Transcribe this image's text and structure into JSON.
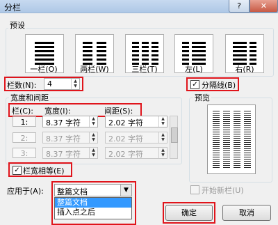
{
  "window": {
    "title": "分栏",
    "help_label": "?",
    "close_label": "✕"
  },
  "presets": {
    "label": "预设",
    "items": [
      {
        "label": "一栏(O)"
      },
      {
        "label": "两栏(W)"
      },
      {
        "label": "三栏(T)"
      },
      {
        "label": "左(L)"
      },
      {
        "label": "右(R)"
      }
    ]
  },
  "columns": {
    "label": "栏数(N):",
    "value": "4"
  },
  "divider": {
    "label": "分隔线(B)",
    "checked": true
  },
  "width_spacing": {
    "label": "宽度和间距",
    "col_header": "栏(C):",
    "width_header": "宽度(I):",
    "spacing_header": "间距(S):",
    "rows": [
      {
        "num": "1:",
        "width": "8.37 字符",
        "spacing": "2.02 字符"
      },
      {
        "num": "2:",
        "width": "8.37 字符",
        "spacing": "2.02 字符"
      },
      {
        "num": "3:",
        "width": "8.37 字符",
        "spacing": "2.02 字符"
      }
    ]
  },
  "equal_width": {
    "label": "栏宽相等(E)",
    "checked": true
  },
  "preview": {
    "label": "预览"
  },
  "apply_to": {
    "label": "应用于(A):",
    "selected": "整篇文档",
    "options": [
      "整篇文档",
      "插入点之后"
    ]
  },
  "new_column": {
    "label": "开始新栏(U)"
  },
  "buttons": {
    "ok": "确定",
    "cancel": "取消"
  }
}
